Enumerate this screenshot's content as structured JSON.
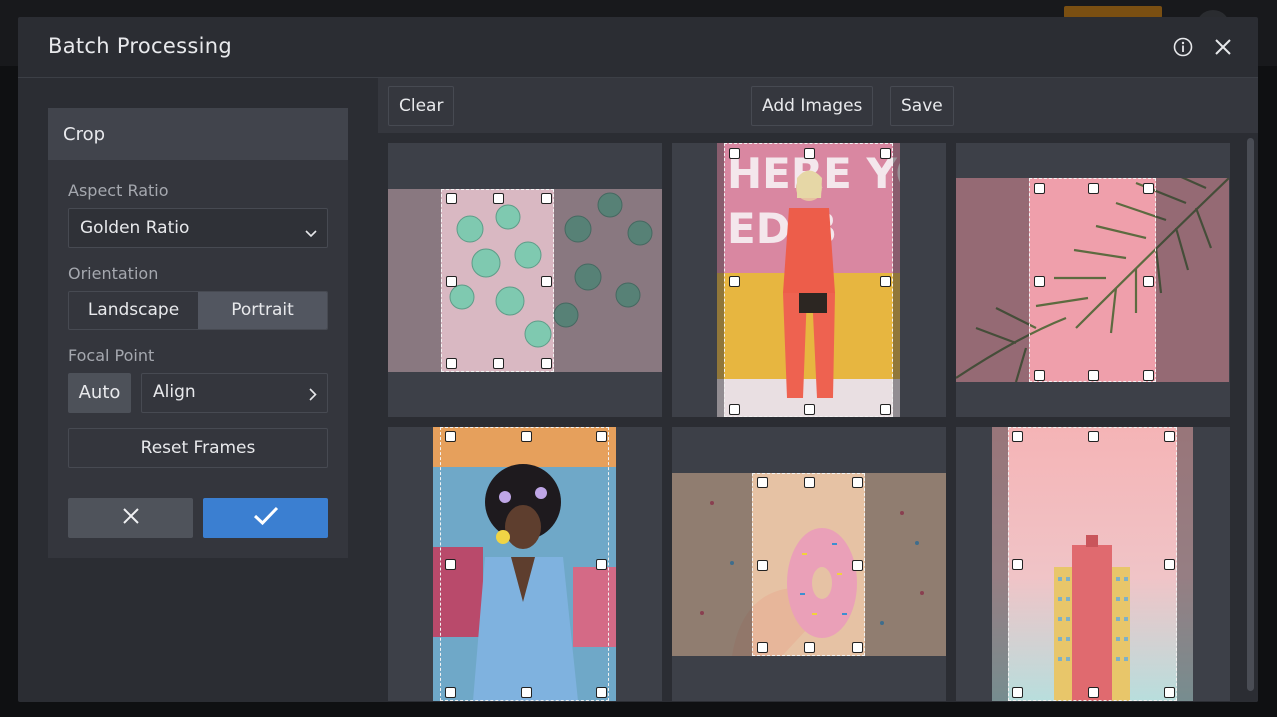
{
  "dialog": {
    "title": "Batch Processing",
    "info_icon": "info-icon",
    "close_icon": "close-icon"
  },
  "panel": {
    "title": "Crop",
    "aspect_ratio_label": "Aspect Ratio",
    "aspect_ratio_value": "Golden Ratio",
    "orientation_label": "Orientation",
    "orientation_options": [
      "Landscape",
      "Portrait"
    ],
    "orientation_selected": "Portrait",
    "focal_point_label": "Focal Point",
    "auto_label": "Auto",
    "align_label": "Align",
    "reset_label": "Reset Frames",
    "cancel_icon": "close-icon",
    "confirm_icon": "check-icon"
  },
  "toolbar": {
    "clear_label": "Clear",
    "add_images_label": "Add Images",
    "save_label": "Save"
  },
  "images": [
    {
      "subject": "mint cupcakes on pink",
      "orientation": "landscape"
    },
    {
      "subject": "woman in coral jumpsuit",
      "orientation": "portrait"
    },
    {
      "subject": "palm leaf on pink",
      "orientation": "landscape"
    },
    {
      "subject": "woman in denim jacket",
      "orientation": "portrait"
    },
    {
      "subject": "sprinkled donut",
      "orientation": "landscape"
    },
    {
      "subject": "pink building tower",
      "orientation": "portrait"
    }
  ],
  "colors": {
    "accent": "#3b7fd1",
    "modal_bg": "#2b2d33",
    "panel_bg": "#34363d"
  }
}
